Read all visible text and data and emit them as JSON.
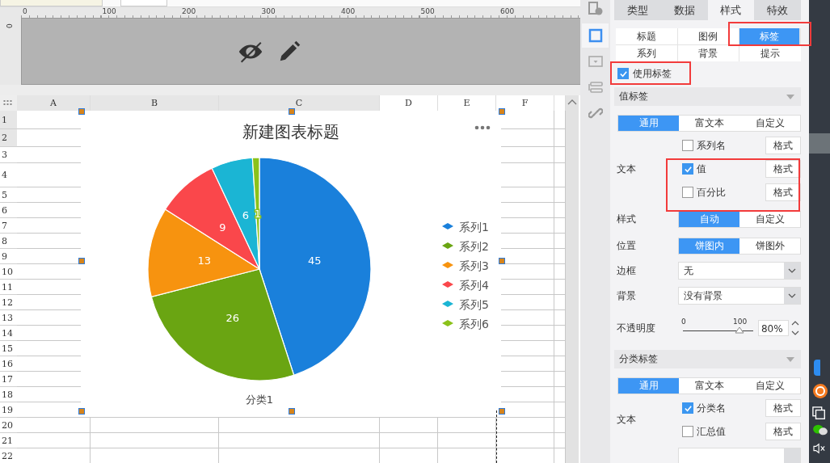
{
  "ruler": {
    "ticks": [
      "0",
      "100",
      "200",
      "300",
      "400",
      "500",
      "600"
    ],
    "vertical_ticks": [
      "0"
    ]
  },
  "sheet": {
    "columns": [
      {
        "label": "A",
        "selected": true
      },
      {
        "label": "B",
        "selected": true
      },
      {
        "label": "C",
        "selected": true
      },
      {
        "label": "D",
        "selected": false
      },
      {
        "label": "E",
        "selected": false
      },
      {
        "label": "F",
        "selected": false
      }
    ],
    "rows": [
      {
        "label": "1",
        "selected": true
      },
      {
        "label": "2",
        "selected": true
      },
      {
        "label": "3",
        "selected": false
      },
      {
        "label": "4",
        "selected": false
      },
      {
        "label": "5",
        "selected": false
      },
      {
        "label": "6",
        "selected": false
      },
      {
        "label": "7",
        "selected": false
      },
      {
        "label": "8",
        "selected": false
      },
      {
        "label": "9",
        "selected": false
      },
      {
        "label": "10",
        "selected": false
      },
      {
        "label": "11",
        "selected": false
      },
      {
        "label": "12",
        "selected": false
      },
      {
        "label": "13",
        "selected": false
      },
      {
        "label": "14",
        "selected": false
      },
      {
        "label": "15",
        "selected": false
      },
      {
        "label": "16",
        "selected": false
      },
      {
        "label": "17",
        "selected": false
      },
      {
        "label": "18",
        "selected": false
      },
      {
        "label": "19",
        "selected": false
      },
      {
        "label": "20",
        "selected": false
      },
      {
        "label": "21",
        "selected": false
      },
      {
        "label": "22",
        "selected": false
      }
    ]
  },
  "chart": {
    "chart_data": {
      "type": "pie",
      "title": "新建图表标题",
      "categories": [
        "系列1",
        "系列2",
        "系列3",
        "系列4",
        "系列5",
        "系列6"
      ],
      "data_labels": true,
      "legend": true,
      "series": [
        {
          "name": "分类1",
          "values": [
            45,
            26,
            13,
            9,
            6,
            1
          ]
        }
      ]
    },
    "slices": [
      {
        "color": "#1a80db"
      },
      {
        "color": "#6aa512"
      },
      {
        "color": "#f7930f"
      },
      {
        "color": "#fa474b"
      },
      {
        "color": "#1bb5d4"
      },
      {
        "color": "#8bc21a"
      }
    ]
  },
  "tool_strip": [
    {
      "kind": "info",
      "selected": false
    },
    {
      "kind": "frame",
      "selected": true
    },
    {
      "kind": "dropdown",
      "selected": false
    },
    {
      "kind": "widget",
      "selected": false
    },
    {
      "kind": "link",
      "selected": false
    }
  ],
  "panel": {
    "tabs": [
      {
        "label": "类型",
        "selected": false
      },
      {
        "label": "数据",
        "selected": false
      },
      {
        "label": "样式",
        "selected": true
      },
      {
        "label": "特效",
        "selected": false
      }
    ],
    "subtabs": [
      {
        "label": "标题",
        "selected": false
      },
      {
        "label": "图例",
        "selected": false
      },
      {
        "label": "标签",
        "selected": true
      },
      {
        "label": "系列",
        "selected": false
      },
      {
        "label": "背景",
        "selected": false
      },
      {
        "label": "提示",
        "selected": false
      }
    ],
    "use_label": {
      "label": "使用标签",
      "checked": true
    },
    "value_label": {
      "title": "值标签",
      "modes": [
        {
          "label": "通用",
          "selected": true
        },
        {
          "label": "富文本",
          "selected": false
        },
        {
          "label": "自定义",
          "selected": false
        }
      ],
      "text_label": "文本",
      "text_options": [
        {
          "label": "系列名",
          "checked": false,
          "button": "格式"
        },
        {
          "label": "值",
          "checked": true,
          "button": "格式"
        },
        {
          "label": "百分比",
          "checked": false,
          "button": "格式"
        }
      ],
      "style": {
        "label": "样式",
        "options": [
          {
            "label": "自动",
            "selected": true
          },
          {
            "label": "自定义",
            "selected": false
          }
        ]
      },
      "position": {
        "label": "位置",
        "options": [
          {
            "label": "饼图内",
            "selected": true
          },
          {
            "label": "饼图外",
            "selected": false
          }
        ]
      },
      "border": {
        "label": "边框",
        "value": "无"
      },
      "background": {
        "label": "背景",
        "value": "没有背景"
      },
      "opacity": {
        "label": "不透明度",
        "min": "0",
        "max": "100",
        "level": 0.8,
        "value": "80%"
      }
    },
    "category_label": {
      "title": "分类标签",
      "modes": [
        {
          "label": "通用",
          "selected": true
        },
        {
          "label": "富文本",
          "selected": false
        },
        {
          "label": "自定义",
          "selected": false
        }
      ],
      "text_label": "文本",
      "text_options": [
        {
          "label": "分类名",
          "checked": true,
          "button": "格式"
        },
        {
          "label": "汇总值",
          "checked": false,
          "button": "格式"
        }
      ]
    }
  }
}
